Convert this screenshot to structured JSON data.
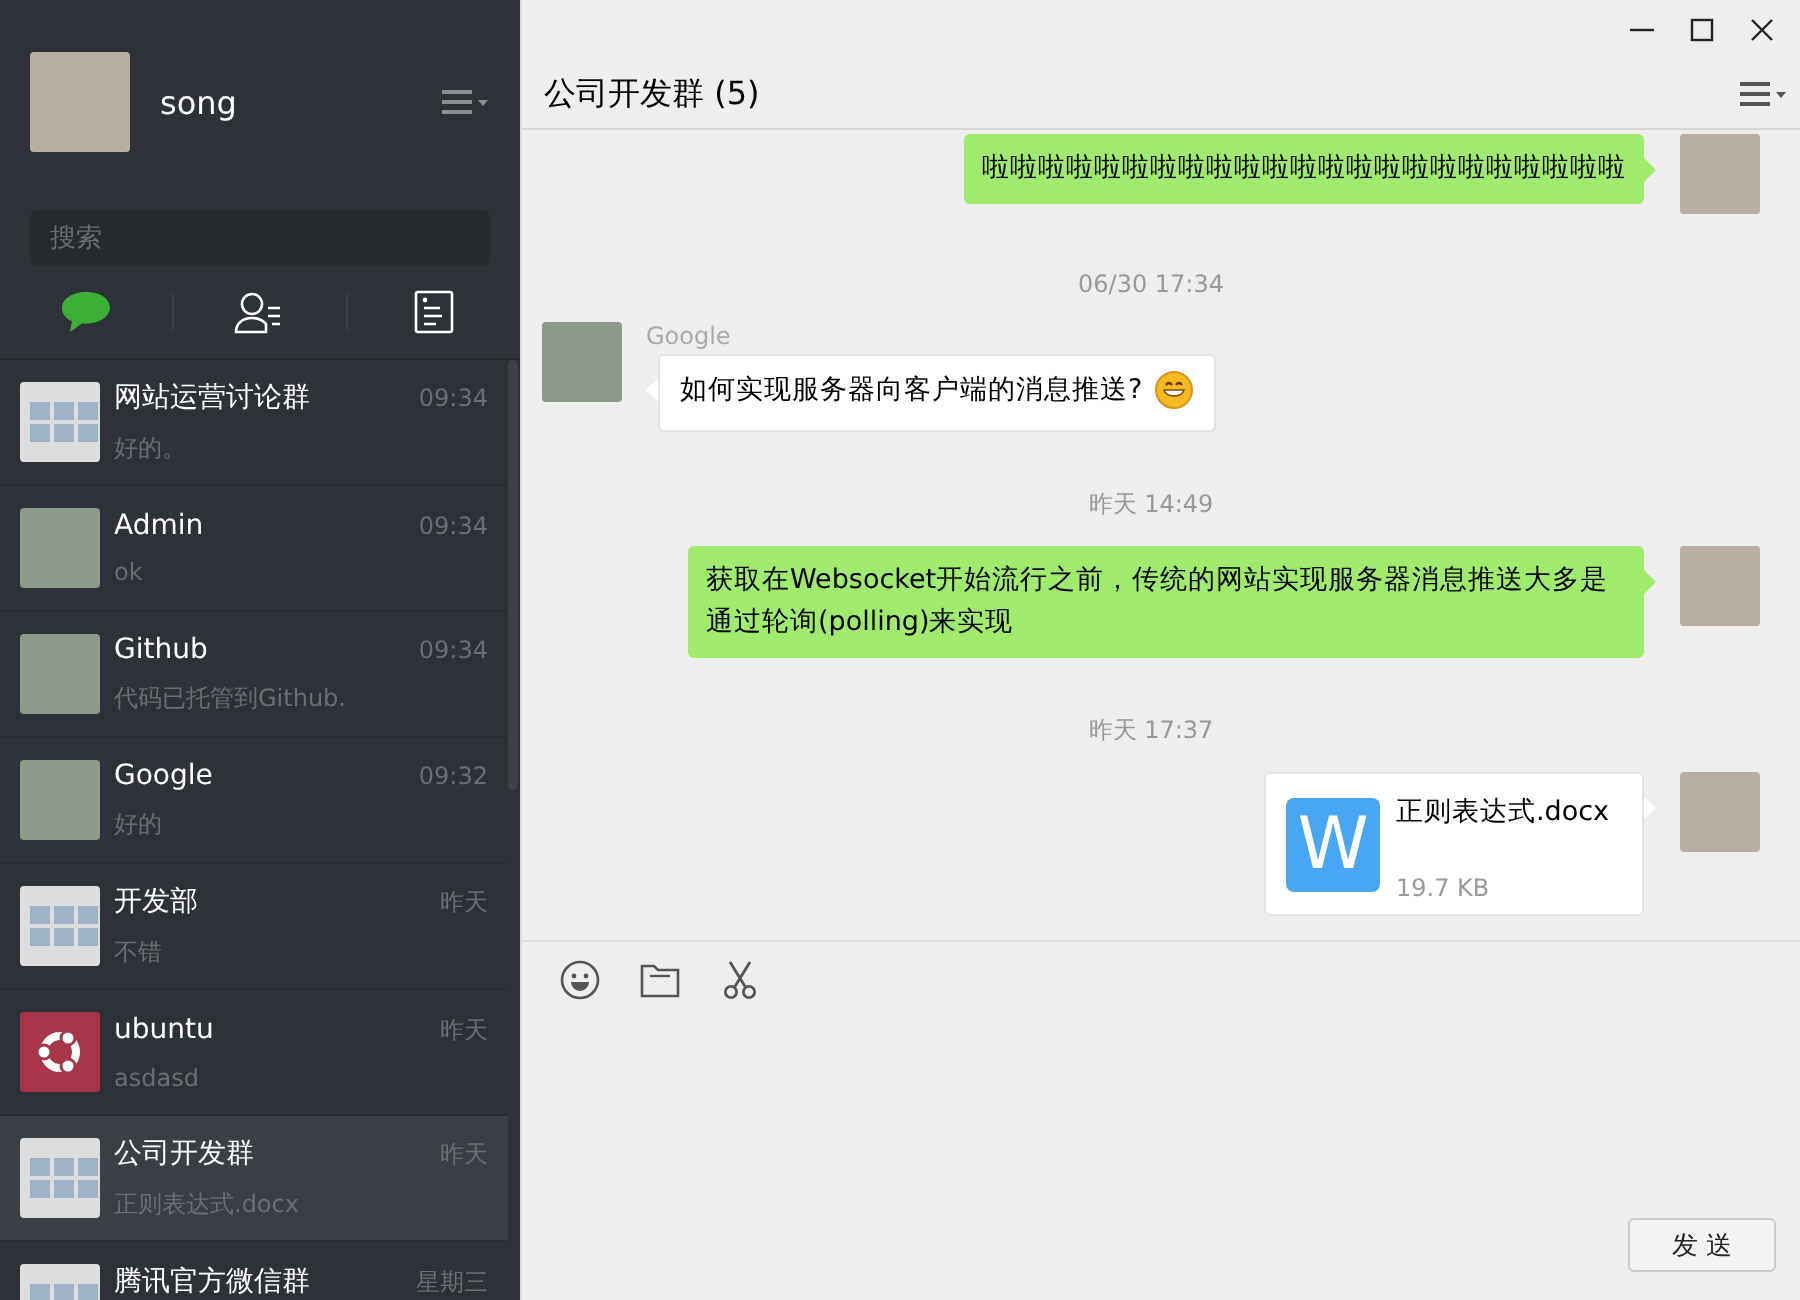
{
  "profile": {
    "name": "song"
  },
  "search": {
    "placeholder": "搜索"
  },
  "nav_tabs": [
    {
      "kind": "chat",
      "selected": true
    },
    {
      "kind": "contacts",
      "selected": false
    },
    {
      "kind": "favorites",
      "selected": false
    }
  ],
  "conversations": [
    {
      "name": "网站运营讨论群",
      "time": "09:34",
      "preview": "好的。",
      "kind": "group",
      "selected": false
    },
    {
      "name": "Admin",
      "time": "09:34",
      "preview": "ok",
      "kind": "photo",
      "selected": false
    },
    {
      "name": "Github",
      "time": "09:34",
      "preview": "代码已托管到Github.",
      "kind": "photo",
      "selected": false
    },
    {
      "name": "Google",
      "time": "09:32",
      "preview": "好的",
      "kind": "photo",
      "selected": false
    },
    {
      "name": "开发部",
      "time": "昨天",
      "preview": "不错",
      "kind": "group",
      "selected": false
    },
    {
      "name": "ubuntu",
      "time": "昨天",
      "preview": "asdasd",
      "kind": "logo",
      "selected": false
    },
    {
      "name": "公司开发群",
      "time": "昨天",
      "preview": "正则表达式.docx",
      "kind": "group",
      "selected": true
    },
    {
      "name": "腾讯官方微信群",
      "time": "星期三",
      "kind": "group",
      "selected": false
    }
  ],
  "chat": {
    "title": "公司开发群 (5)"
  },
  "messages": [
    {
      "kind": "sent",
      "text": "啦啦啦啦啦啦啦啦啦啦啦啦啦啦啦啦啦啦啦啦啦啦啦"
    },
    {
      "kind": "time",
      "text": "06/30 17:34"
    },
    {
      "kind": "received",
      "sender": "Google",
      "text": "如何实现服务器向客户端的消息推送?",
      "emoji": true
    },
    {
      "kind": "time",
      "text": "昨天 14:49"
    },
    {
      "kind": "sent",
      "text": "获取在Websocket开始流行之前，传统的网站实现服务器消息推送大多是通过轮询(polling)来实现"
    },
    {
      "kind": "time",
      "text": "昨天 17:37"
    },
    {
      "kind": "file",
      "file_icon": "W",
      "file_name": "正则表达式.docx",
      "size": "19.7 KB"
    }
  ],
  "composer": {
    "send_button": "发 送"
  }
}
